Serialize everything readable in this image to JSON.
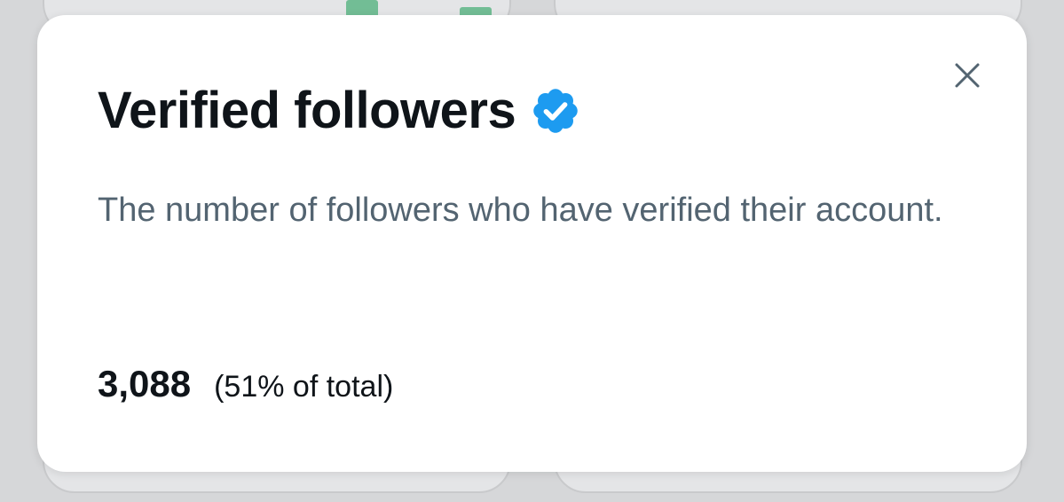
{
  "modal": {
    "title": "Verified followers",
    "description": "The number of followers who have verified their account.",
    "stat": {
      "value": "3,088",
      "share": "(51% of total)"
    },
    "close_icon": "close-icon",
    "badge_icon": "verified-badge-icon"
  },
  "colors": {
    "badge": "#1d9bf0",
    "title_text": "#0f1419",
    "secondary_text": "#536471",
    "backdrop": "#d6d7d9",
    "chart_bar": "#72bd95"
  }
}
